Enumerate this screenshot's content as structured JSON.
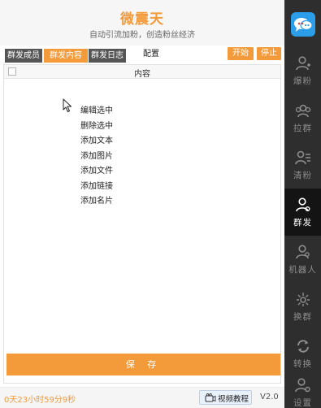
{
  "header": {
    "title": "微震天",
    "subtitle": "自动引流加粉，创造粉丝经济"
  },
  "tabs": [
    {
      "label": "群发成员"
    },
    {
      "label": "群发内容"
    },
    {
      "label": "群发日志"
    }
  ],
  "config_label": "配置",
  "actions": {
    "start_label": "开始",
    "stop_label": "停止"
  },
  "table": {
    "column_header": "内容"
  },
  "context_menu": [
    {
      "label": "编辑选中"
    },
    {
      "label": "删除选中"
    },
    {
      "label": "添加文本"
    },
    {
      "label": "添加图片"
    },
    {
      "label": "添加文件"
    },
    {
      "label": "添加链接"
    },
    {
      "label": "添加名片"
    }
  ],
  "save_label": "保 存",
  "footer": {
    "timer": "0天23小时59分9秒",
    "video_label": "视频教程",
    "version": "V2.0"
  },
  "sidebar": {
    "items": [
      {
        "label": "爆粉",
        "icon": "add-user-icon"
      },
      {
        "label": "拉群",
        "icon": "group-icon"
      },
      {
        "label": "清粉",
        "icon": "user-list-icon"
      },
      {
        "label": "群发",
        "icon": "user-broadcast-icon"
      },
      {
        "label": "机器人",
        "icon": "robot-icon"
      },
      {
        "label": "换群",
        "icon": "burst-icon"
      },
      {
        "label": "转换",
        "icon": "refresh-icon"
      },
      {
        "label": "设置",
        "icon": "user-settings-icon"
      }
    ]
  },
  "colors": {
    "accent": "#f39a3b",
    "sidebar_bg": "#2e2e2e",
    "sidebar_active": "#141414",
    "logo_bg": "#2b9de9"
  }
}
